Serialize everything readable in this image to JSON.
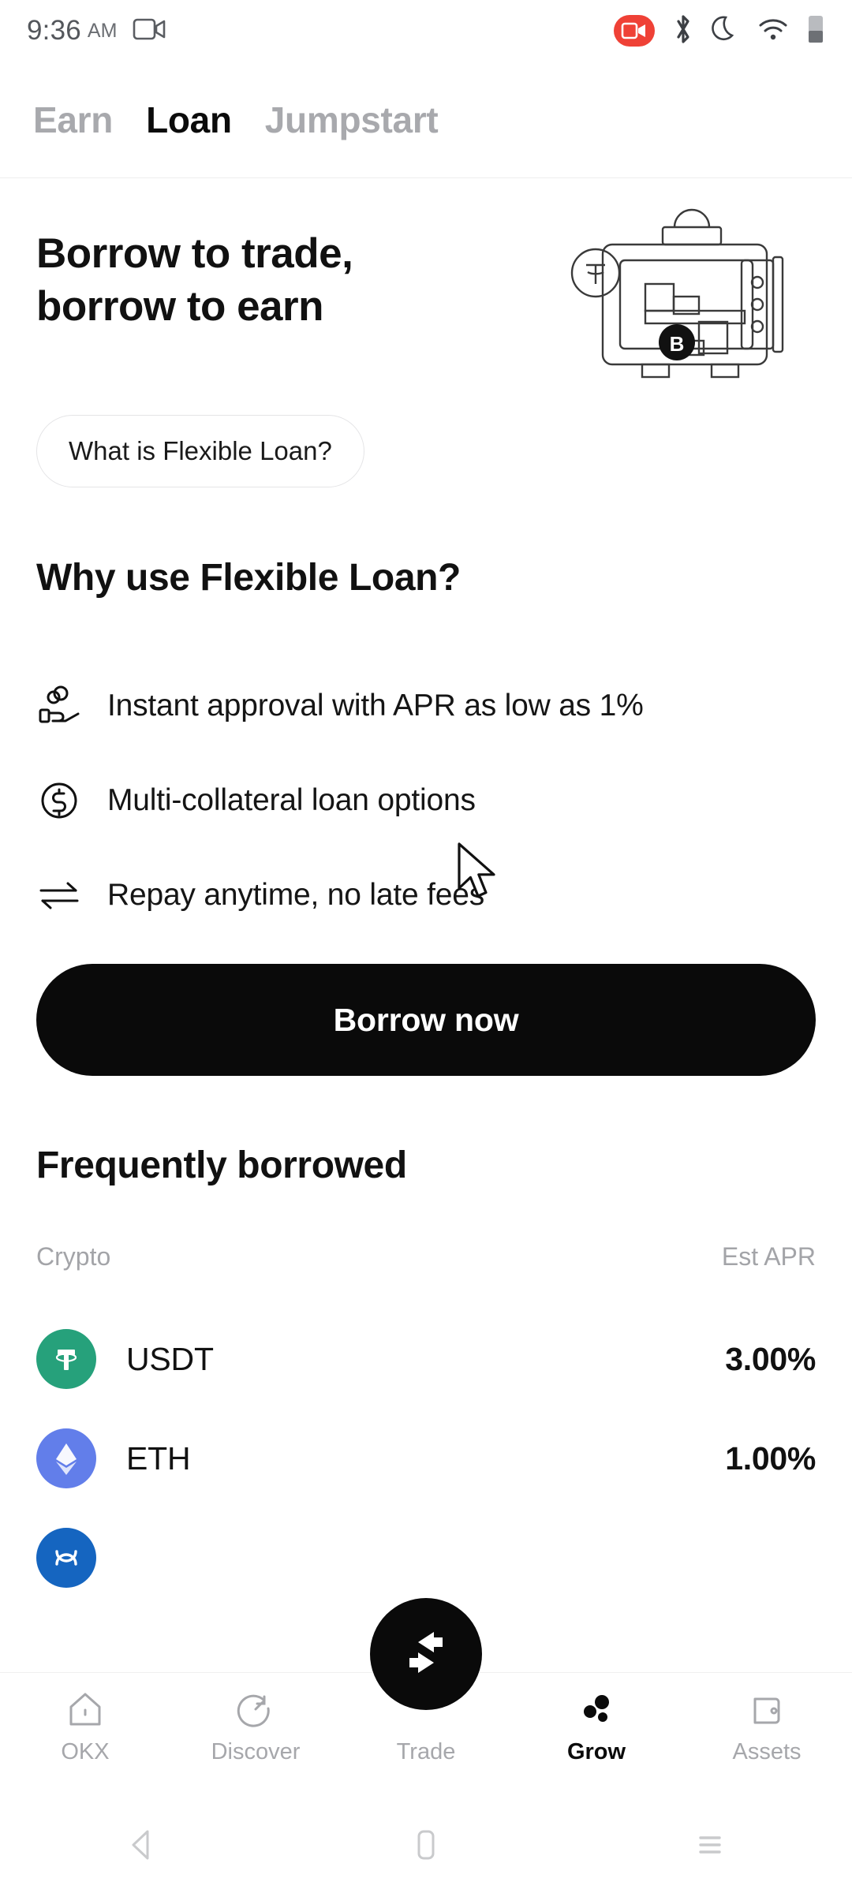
{
  "status_bar": {
    "time": "9:36",
    "meridiem": "AM",
    "screen_record_icon": "screen-record-icon",
    "recording_badge_icon": "recording-badge-icon",
    "bluetooth_icon": "bluetooth-icon",
    "dnd_icon": "do-not-disturb-moon-icon",
    "wifi_icon": "wifi-icon",
    "battery_icon": "battery-icon"
  },
  "tabs": [
    {
      "label": "Earn",
      "active": false
    },
    {
      "label": "Loan",
      "active": true
    },
    {
      "label": "Jumpstart",
      "active": false
    }
  ],
  "hero": {
    "title": "Borrow to trade,\nborrow to earn",
    "pill_label": "What is Flexible Loan?",
    "illustration": "vault-safe-with-crypto-illustration"
  },
  "why": {
    "title": "Why use Flexible Loan?",
    "features": [
      {
        "icon": "hand-holding-coins-icon",
        "text": "Instant approval with APR as low as 1%"
      },
      {
        "icon": "dollar-circle-icon",
        "text": "Multi-collateral loan options"
      },
      {
        "icon": "swap-arrows-icon",
        "text": "Repay anytime, no late fees"
      }
    ]
  },
  "cta": {
    "label": "Borrow now"
  },
  "frequently_borrowed": {
    "title": "Frequently borrowed",
    "col_crypto": "Crypto",
    "col_apr": "Est APR",
    "rows": [
      {
        "symbol": "USDT",
        "apr": "3.00%",
        "color": "#26A17B",
        "icon": "tether-icon"
      },
      {
        "symbol": "ETH",
        "apr": "1.00%",
        "color": "#627EEA",
        "icon": "ethereum-icon"
      },
      {
        "symbol": "",
        "apr": "",
        "color": "#1565C0",
        "icon": "crypto-coin-icon"
      }
    ]
  },
  "bottom_nav": {
    "items": [
      {
        "label": "OKX",
        "icon": "home-icon",
        "active": false
      },
      {
        "label": "Discover",
        "icon": "compass-icon",
        "active": false
      },
      {
        "label": "Trade",
        "icon": "swap-icon",
        "active": false
      },
      {
        "label": "Grow",
        "icon": "grow-dots-icon",
        "active": true
      },
      {
        "label": "Assets",
        "icon": "wallet-icon",
        "active": false
      }
    ]
  },
  "android_nav": {
    "back": "back-triangle-icon",
    "home": "home-square-icon",
    "recents": "recents-lines-icon"
  },
  "colors": {
    "accent_black": "#0A0A0A",
    "muted_gray": "#A6A7AB",
    "recording_red": "#EF4136",
    "usdt_green": "#26A17B",
    "eth_blue": "#627EEA"
  }
}
